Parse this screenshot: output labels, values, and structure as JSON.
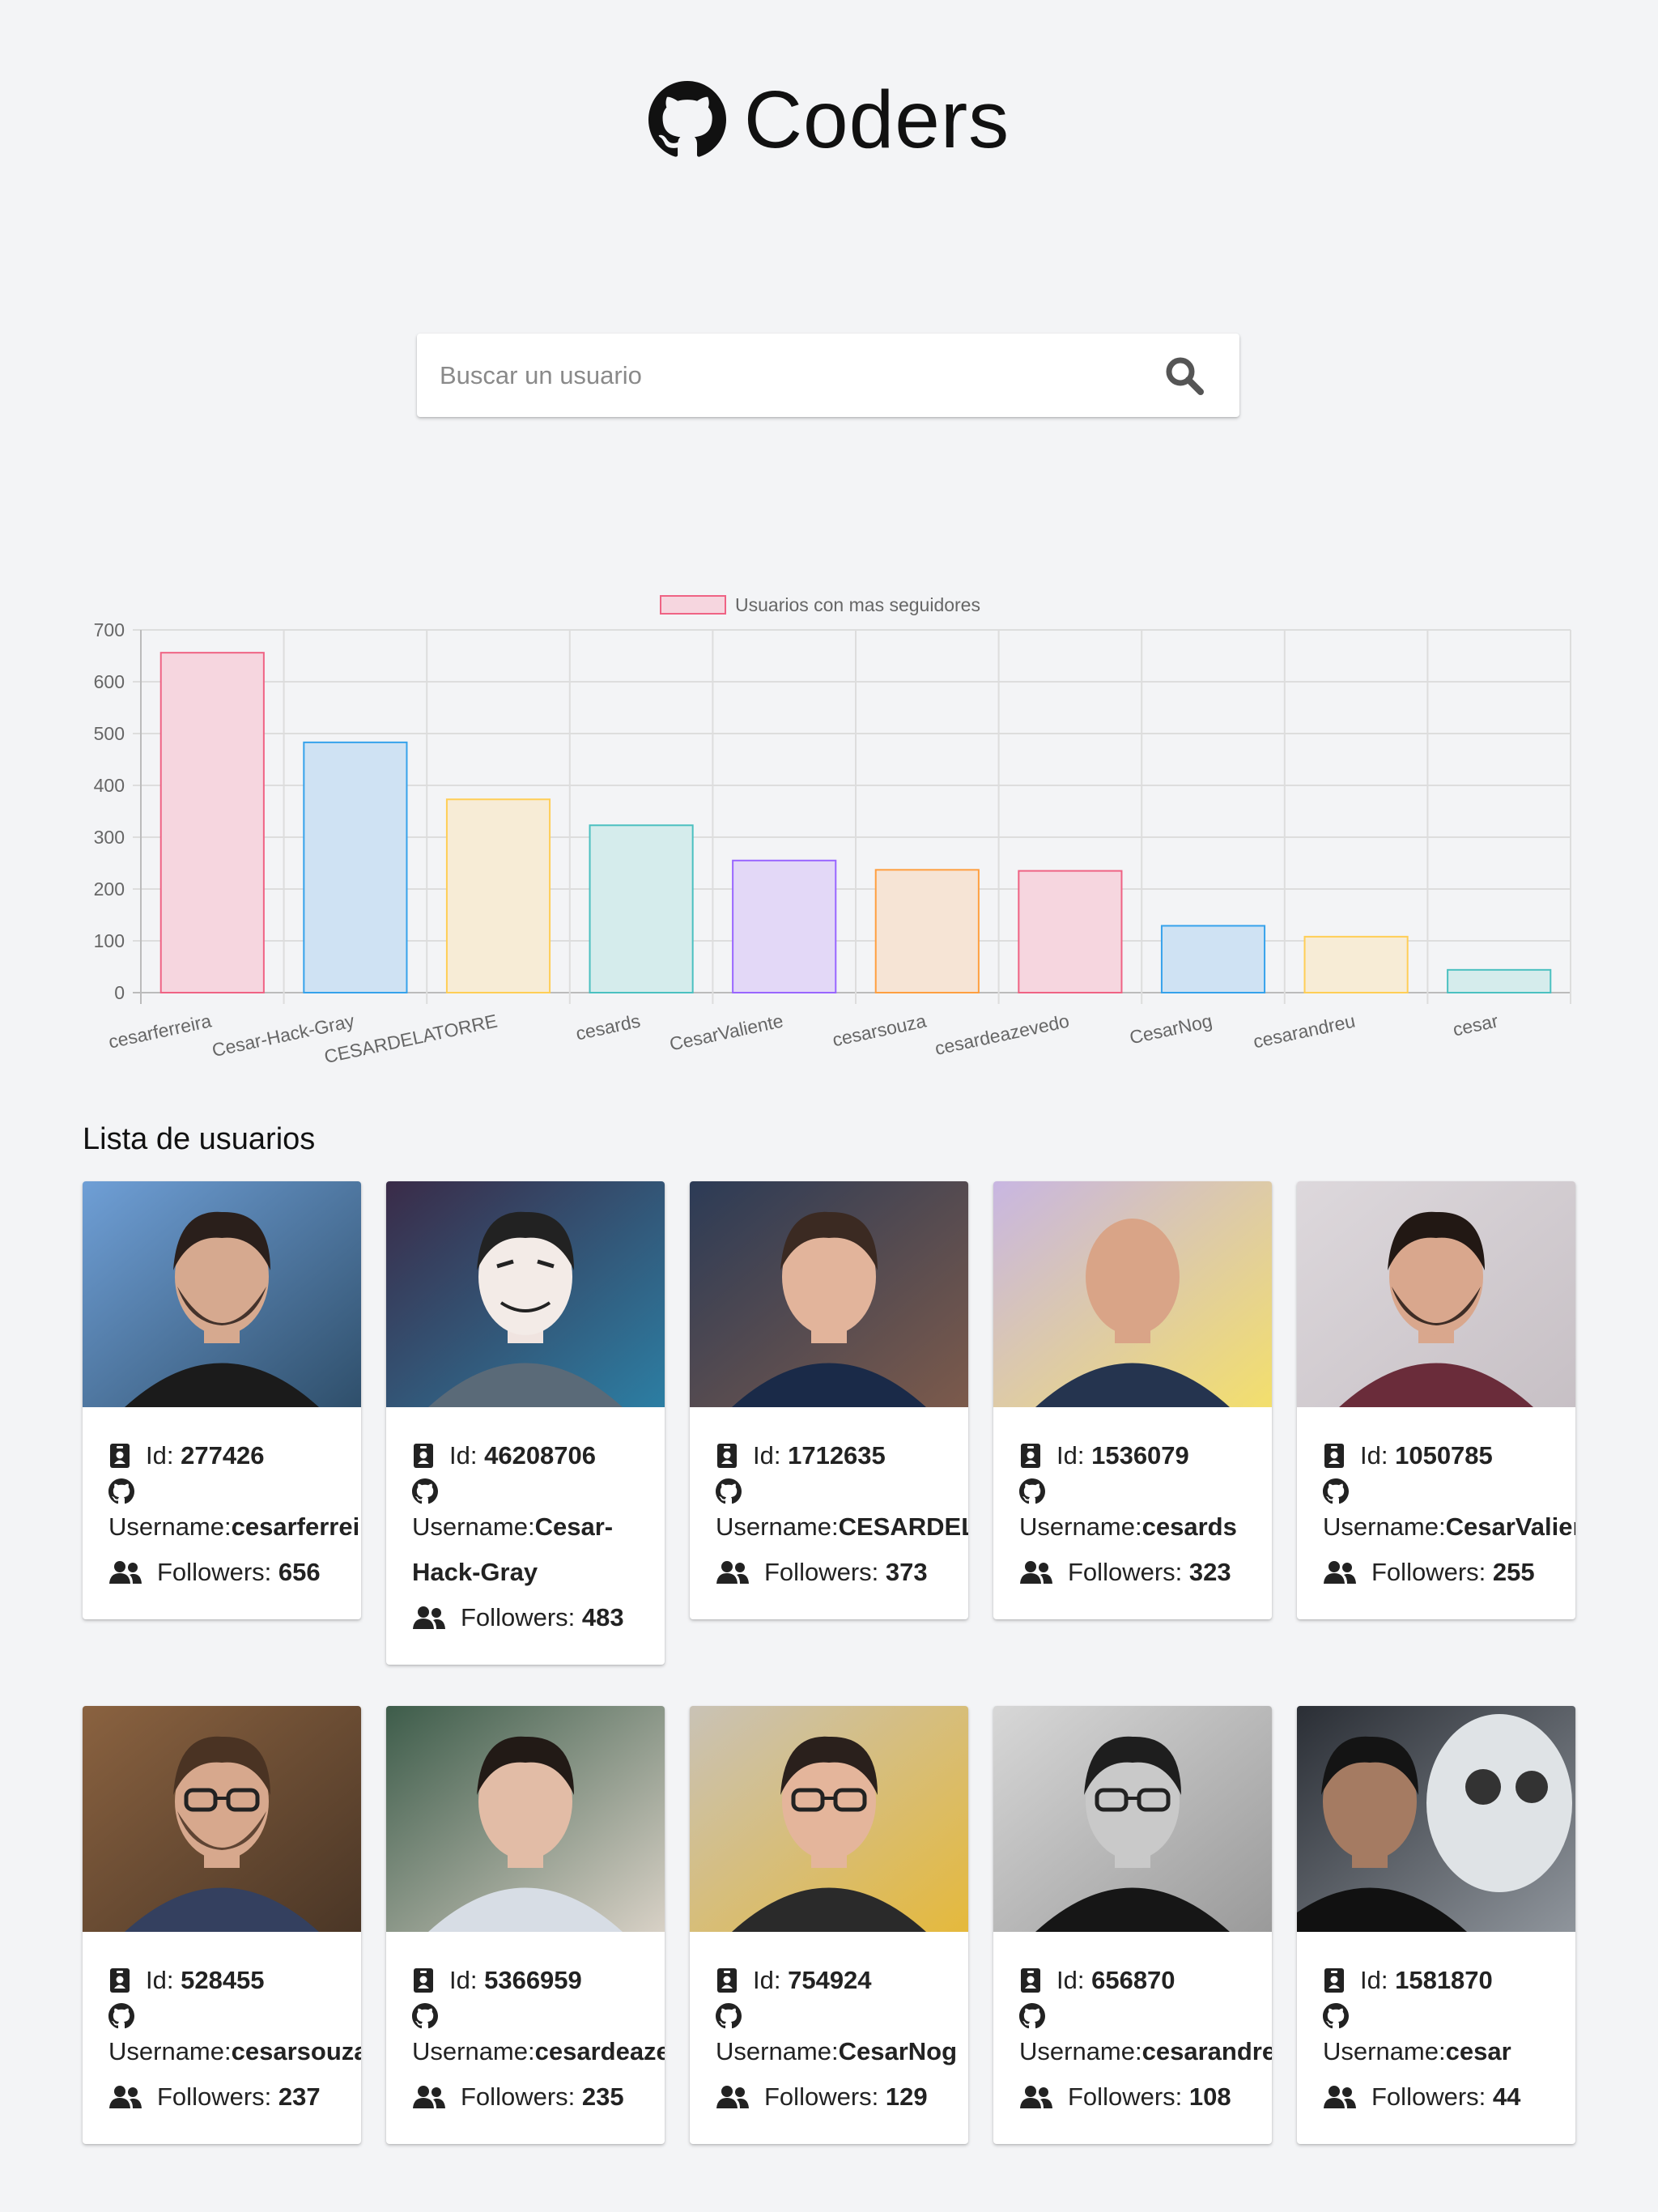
{
  "app": {
    "title": "Coders"
  },
  "search": {
    "placeholder": "Buscar un usuario"
  },
  "chart_data": {
    "type": "bar",
    "legend": "Usuarios con mas seguidores",
    "categories": [
      "cesarferreira",
      "Cesar-Hack-Gray",
      "CESARDELATORRE",
      "cesards",
      "CesarValiente",
      "cesarsouza",
      "cesardeazevedo",
      "CesarNog",
      "cesarandreu",
      "cesar"
    ],
    "values": [
      656,
      483,
      373,
      323,
      255,
      237,
      235,
      129,
      108,
      44
    ],
    "ylim": [
      0,
      700
    ],
    "yticks": [
      0,
      100,
      200,
      300,
      400,
      500,
      600,
      700
    ],
    "grid": true,
    "legend_position": "top",
    "fill_colors": [
      "#f6d6df",
      "#cfe2f3",
      "#f7ecd6",
      "#d5ecec",
      "#e3d8f7",
      "#f6e4d5",
      "#f6d6df",
      "#cfe2f3",
      "#f7ecd6",
      "#d5ecec"
    ],
    "stroke_colors": [
      "#ef6384",
      "#36a2eb",
      "#ffce56",
      "#4bc0c0",
      "#9966ff",
      "#ff9f40",
      "#ef6384",
      "#36a2eb",
      "#ffce56",
      "#4bc0c0"
    ]
  },
  "list": {
    "title": "Lista de usuarios",
    "id_label": "Id:",
    "username_label": "Username:",
    "followers_label": "Followers:",
    "users": [
      {
        "id": "277426",
        "username": "cesarferreira",
        "followers": "656",
        "avatar": "bearded-man-lake"
      },
      {
        "id": "46208706",
        "username": "Cesar-Hack-Gray",
        "followers": "483",
        "avatar": "anonymous-mask"
      },
      {
        "id": "1712635",
        "username": "CESARDELATORRE",
        "followers": "373",
        "avatar": "smiling-man-jacket"
      },
      {
        "id": "1536079",
        "username": "cesards",
        "followers": "323",
        "avatar": "bald-man-colored-bg"
      },
      {
        "id": "1050785",
        "username": "CesarValiente",
        "followers": "255",
        "avatar": "bearded-man-grey-bg"
      },
      {
        "id": "528455",
        "username": "cesarsouza",
        "followers": "237",
        "avatar": "man-glasses-plaid"
      },
      {
        "id": "5366959",
        "username": "cesardeazevedo",
        "followers": "235",
        "avatar": "young-man-profile"
      },
      {
        "id": "754924",
        "username": "CesarNog",
        "followers": "129",
        "avatar": "man-glasses-buildings"
      },
      {
        "id": "656870",
        "username": "cesarandreu",
        "followers": "108",
        "avatar": "grayscale-person-sunglasses"
      },
      {
        "id": "1581870",
        "username": "cesar",
        "followers": "44",
        "avatar": "man-with-skull-art"
      }
    ]
  }
}
